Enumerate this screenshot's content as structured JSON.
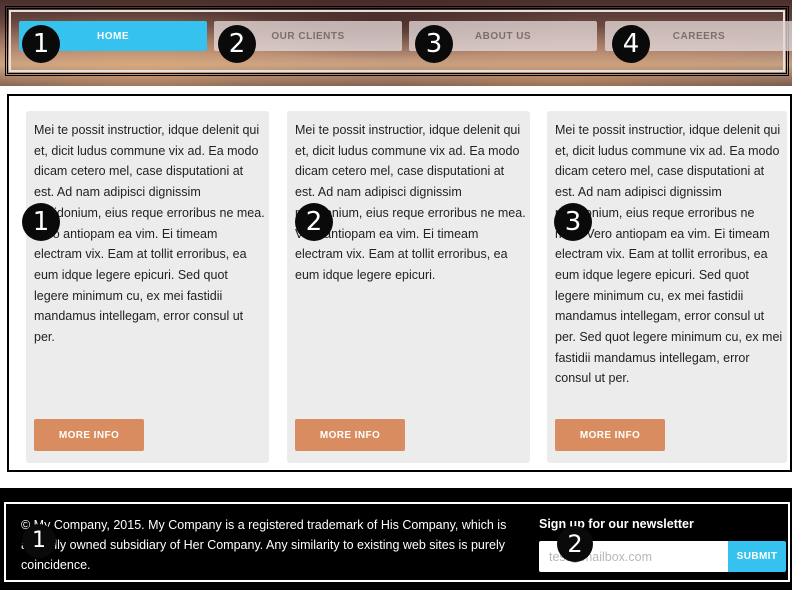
{
  "nav": {
    "items": [
      {
        "label": "HOME",
        "marker": "1"
      },
      {
        "label": "OUR CLIENTS",
        "marker": "2"
      },
      {
        "label": "ABOUT US",
        "marker": "3"
      },
      {
        "label": "CAREERS",
        "marker": "4"
      }
    ],
    "active_index": 0
  },
  "cards": [
    {
      "text": "Mei te possit instructior, idque delenit qui et, dicit ludus commune vix ad. Ea modo dicam cetero mel, case disputationi at est. Ad nam adipisci dignissim posidonium, eius reque erroribus ne mea. Vero antiopam ea vim. Ei timeam electram vix. Eam at tollit erroribus, ea eum idque legere epicuri. Sed quot legere minimum cu, ex mei fastidii mandamus intellegam, error consul ut per.",
      "button": "MORE INFO",
      "marker": "1"
    },
    {
      "text": "Mei te possit instructior, idque delenit qui et, dicit ludus commune vix ad. Ea modo dicam cetero mel, case disputationi at est. Ad nam adipisci dignissim posidonium, eius reque erroribus ne mea. Vero antiopam ea vim. Ei timeam electram vix. Eam at tollit erroribus, ea eum idque legere epicuri.",
      "button": "MORE INFO",
      "marker": "2"
    },
    {
      "text": "Mei te possit instructior, idque delenit qui et, dicit ludus commune vix ad. Ea modo dicam cetero mel, case disputationi at est. Ad nam adipisci dignissim posidonium, eius reque erroribus ne mea. Vero antiopam ea vim. Ei timeam electram vix. Eam at tollit erroribus, ea eum idque legere epicuri. Sed quot legere minimum cu, ex mei fastidii mandamus intellegam, error consul ut per. Sed quot legere minimum cu, ex mei fastidii mandamus intellegam, error consul ut per.",
      "button": "MORE INFO",
      "marker": "3"
    }
  ],
  "footer": {
    "copyright": "© My Company, 2015. My Company is a registered trademark of His Company, which is a wholly owned subsidiary of Her Company. Any similarity to existing web sites is purely coincidence.",
    "newsletter_title": "Sign up for our newsletter",
    "email_placeholder": "test@mailbox.com",
    "submit_label": "SUBMIT",
    "markers": [
      "1",
      "2"
    ]
  },
  "colors": {
    "accent_blue": "#35c2ee",
    "button_orange": "#d98c5f",
    "card_bg": "#ececec"
  }
}
